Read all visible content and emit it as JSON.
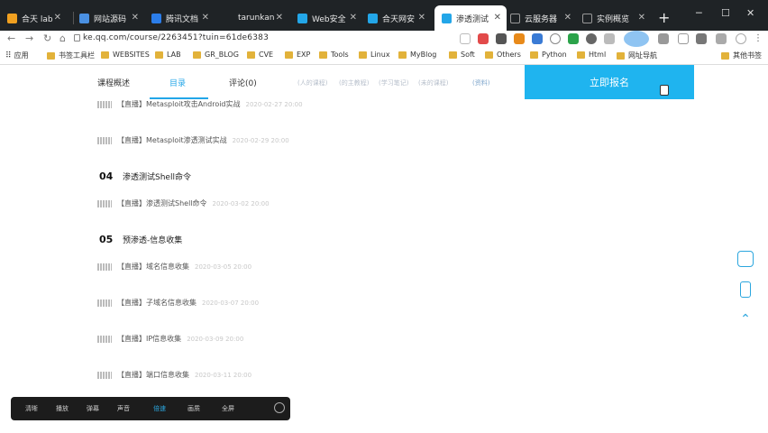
{
  "browser": {
    "tabs": [
      {
        "label": "合天 lab",
        "color": "#f0a020"
      },
      {
        "label": "网站源码",
        "color": "#4a90e2"
      },
      {
        "label": "腾讯文档",
        "color": "#2b7de9"
      },
      {
        "label": "tarunkan",
        "color": "#888888"
      },
      {
        "label": "Web安全",
        "color": "#23a6e8"
      },
      {
        "label": "合天网安",
        "color": "#23a6e8"
      },
      {
        "label": "渗透测试",
        "color": "#23a6e8"
      },
      {
        "label": "云服务器",
        "color": "#888888"
      },
      {
        "label": "实例概览",
        "color": "#888888"
      }
    ],
    "new_tab_label": "+",
    "url": "ke.qq.com/course/2263451?tuin=61de6383",
    "bookmarks": [
      "应用",
      "书签工具栏",
      "WEBSITES",
      "LAB",
      "GR_BLOG",
      "CVE",
      "EXP",
      "Tools",
      "Linux",
      "MyBlog",
      "Soft",
      "Others",
      "Python",
      "Html",
      "网址导航",
      "其他书签"
    ]
  },
  "course": {
    "tabs": [
      "课程概述",
      "目录",
      "评论(0)"
    ],
    "blurred_tabs": [
      "(人的课程)",
      "(的主教程)",
      "(学习笔记)",
      "(未的课程)"
    ],
    "extra_tab": "(资料)",
    "cta_label": "立即报名"
  },
  "lessons": [
    {
      "label": "【直播】Metasploit攻击Android实战",
      "time": "2020-02-27 20:00"
    },
    {
      "label": "【直播】Metasploit渗透测试实战",
      "time": "2020-02-29 20:00"
    },
    {
      "label": "【直播】渗透测试Shell命令",
      "time": "2020-03-02 20:00"
    },
    {
      "label": "【直播】域名信息收集",
      "time": "2020-03-05 20:00"
    },
    {
      "label": "【直播】子域名信息收集",
      "time": "2020-03-07 20:00"
    },
    {
      "label": "【直播】IP信息收集",
      "time": "2020-03-09 20:00"
    },
    {
      "label": "【直播】端口信息收集",
      "time": "2020-03-11 20:00"
    }
  ],
  "chapters": [
    {
      "num": "04",
      "title": "渗透测试Shell命令"
    },
    {
      "num": "05",
      "title": "预渗透-信息收集"
    }
  ],
  "player": {
    "controls": [
      "清晰",
      "播放",
      "弹幕",
      "声音",
      "倍速",
      "画质",
      "全屏"
    ],
    "active_index": 4
  }
}
